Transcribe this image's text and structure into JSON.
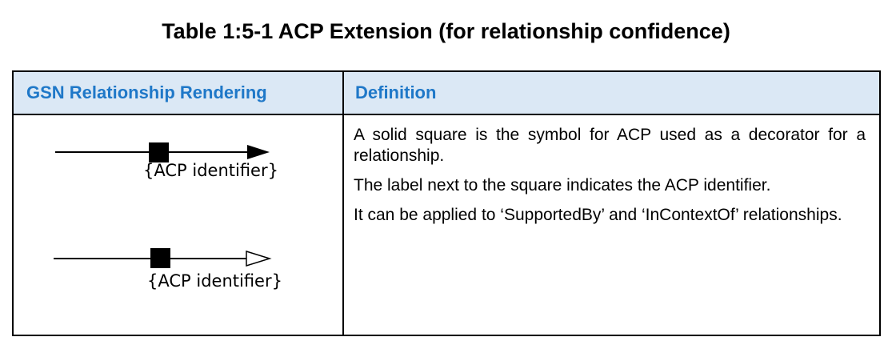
{
  "caption": "Table 1:5-1 ACP Extension (for relationship confidence)",
  "table": {
    "headers": {
      "rendering": "GSN Relationship Rendering",
      "definition": "Definition"
    },
    "rendering": {
      "symbols": [
        {
          "arrowhead": "solid",
          "label": "{ACP identifier}"
        },
        {
          "arrowhead": "hollow",
          "label": "{ACP identifier}"
        }
      ]
    },
    "definition": {
      "paragraphs": [
        "A solid square is the symbol for ACP used as a decorator for a relationship.",
        "The label next to the square indicates the ACP identifier.",
        "It can be applied to ‘SupportedBy’ and ‘InContextOf’ relationships."
      ]
    }
  },
  "colors": {
    "header_background": "#dbe8f5",
    "header_text": "#1f78c8",
    "border": "#000000"
  }
}
